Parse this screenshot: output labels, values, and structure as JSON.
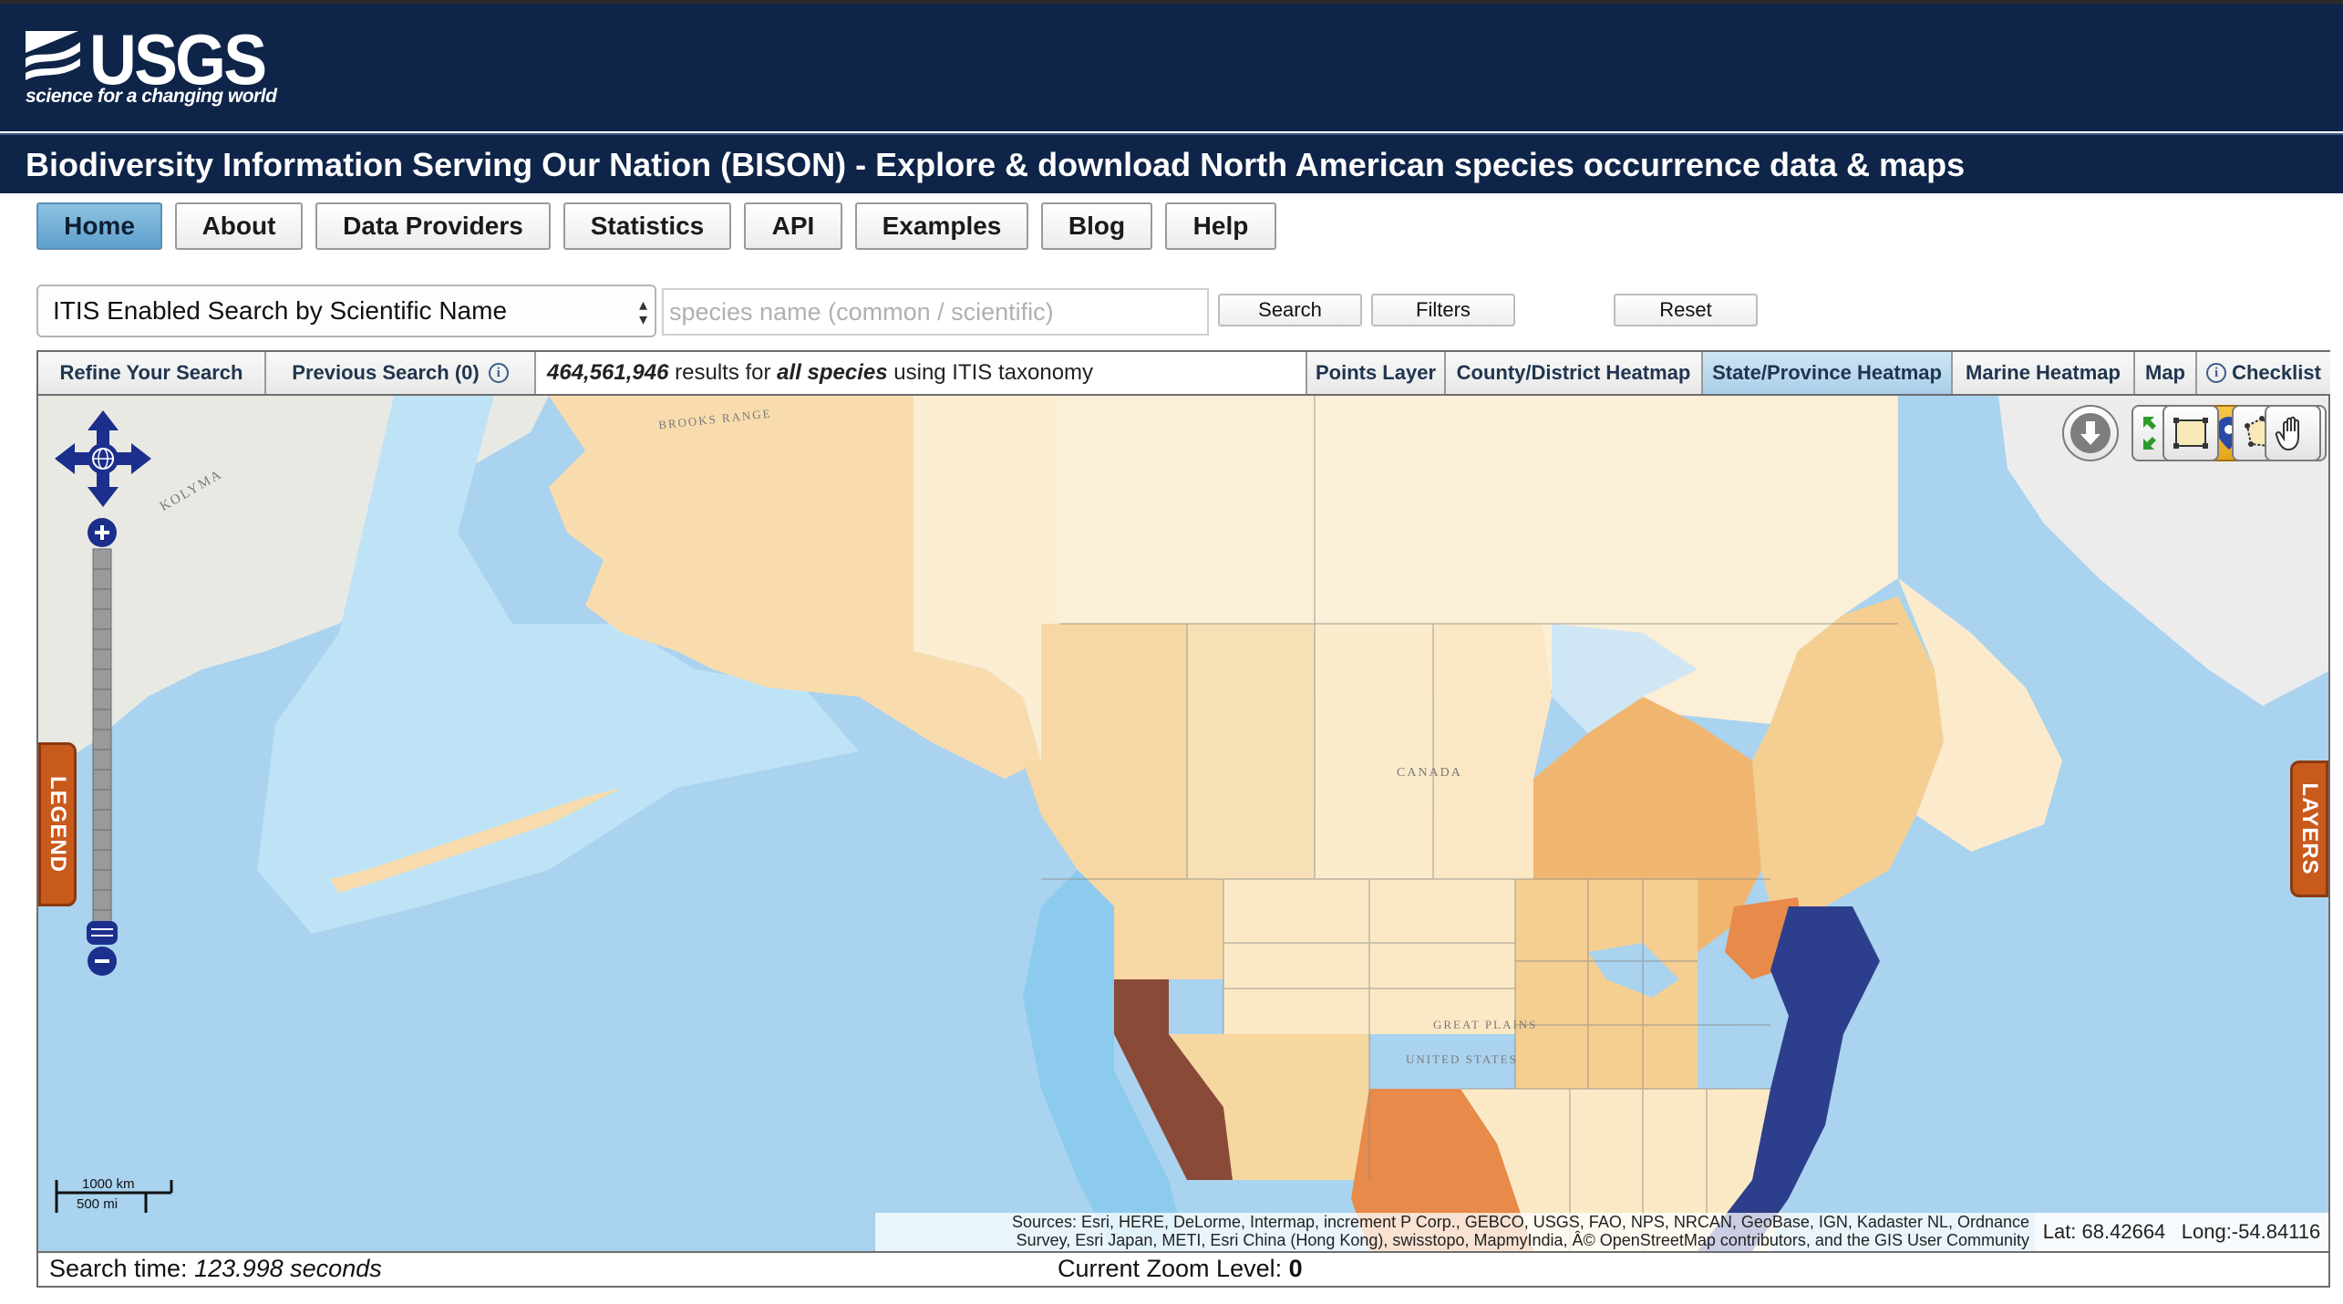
{
  "header": {
    "logo_word": "USGS",
    "logo_tagline": "science for a changing world",
    "title": "Biodiversity Information Serving Our Nation (BISON) - Explore & download North American species occurrence data & maps"
  },
  "nav": {
    "items": [
      "Home",
      "About",
      "Data Providers",
      "Statistics",
      "API",
      "Examples",
      "Blog",
      "Help"
    ],
    "active": "Home"
  },
  "search": {
    "mode_selected": "ITIS Enabled Search by Scientific Name",
    "input_placeholder": "species name (common / scientific)",
    "search_label": "Search",
    "filters_label": "Filters",
    "reset_label": "Reset"
  },
  "toolbar": {
    "refine_label": "Refine Your Search",
    "previous_label": "Previous Search (0)",
    "results_count": "464,561,946",
    "results_mid": " results for ",
    "results_species": "all species",
    "results_tail": " using ITIS taxonomy",
    "tabs": [
      "Points Layer",
      "County/District Heatmap",
      "State/Province Heatmap",
      "Marine Heatmap",
      "Map",
      "Checklist"
    ],
    "active_tab": "State/Province Heatmap"
  },
  "map": {
    "legend_label": "LEGEND",
    "layers_label": "LAYERS",
    "scale_km": "1000 km",
    "scale_mi": "500 mi",
    "attribution_line1": "Sources: Esri, HERE, DeLorme, Intermap, increment P Corp., GEBCO, USGS, FAO, NPS, NRCAN, GeoBase, IGN, Kadaster NL, Ordnance",
    "attribution_line2": "Survey, Esri Japan, METI, Esri China (Hong Kong), swisstopo, MapmyIndia, Â© OpenStreetMap contributors, and the GIS User Community",
    "lat_label": "Lat: 68.42664",
    "long_label": "Long:-54.84116",
    "labels": {
      "canada": "CANADA",
      "united_states": "UNITED STATES",
      "kolyma": "KOLYMA",
      "great_plains": "GREAT PLAINS",
      "brooks": "BROOKS RANGE"
    },
    "tools": [
      "download-icon",
      "full-extent-icon",
      "point-marker-icon",
      "zoom-box-icon",
      "rectangle-select-icon",
      "polygon-select-icon",
      "pan-hand-icon"
    ],
    "active_tool": "point-marker-icon",
    "heat_colors": {
      "lowest": "#fbe9c6",
      "low": "#f7d7a0",
      "mid": "#f0b670",
      "high": "#e88a4a",
      "very_high": "#8a4a38",
      "marine_high": "#2d3f8c",
      "marine_low": "#8ccbee"
    }
  },
  "status": {
    "search_time_label": "Search time: ",
    "search_time_value": "123.998 seconds",
    "zoom_label": "Current Zoom Level: ",
    "zoom_value": "0"
  }
}
